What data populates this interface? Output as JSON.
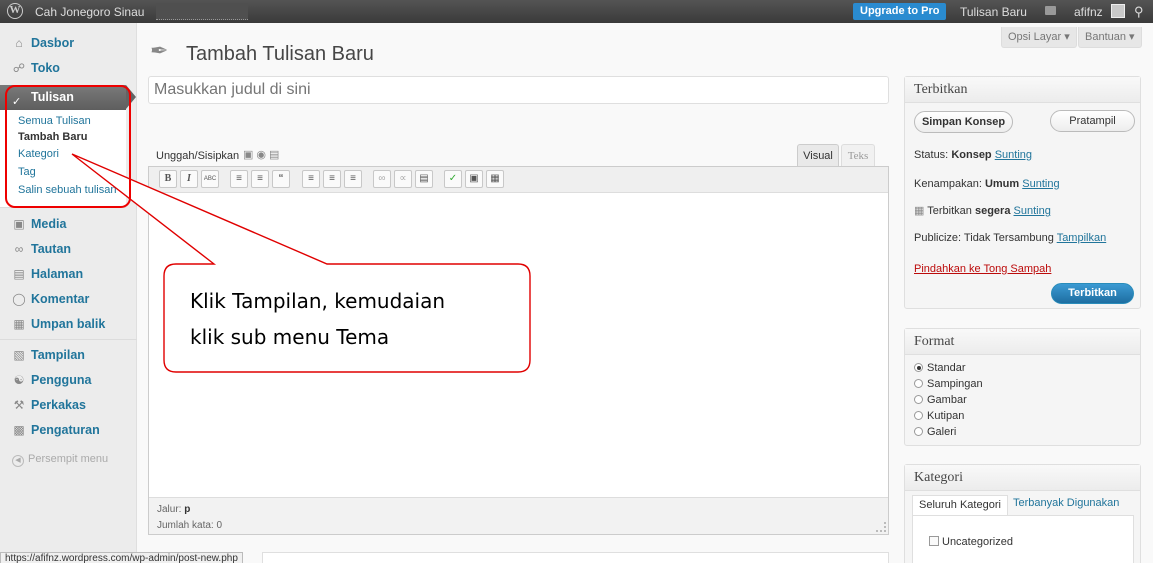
{
  "adminbar": {
    "site_name": "Cah Jonegoro Sinau",
    "upgrade": "Upgrade to Pro",
    "new_post": "Tulisan Baru",
    "user": "afifnz"
  },
  "menu": {
    "dasbor": "Dasbor",
    "toko": "Toko",
    "tulisan": "Tulisan",
    "sub": [
      "Semua Tulisan",
      "Tambah Baru",
      "Kategori",
      "Tag",
      "Salin sebuah tulisan"
    ],
    "media": "Media",
    "tautan": "Tautan",
    "halaman": "Halaman",
    "komentar": "Komentar",
    "umpan": "Umpan balik",
    "tampilan": "Tampilan",
    "pengguna": "Pengguna",
    "perkakas": "Perkakas",
    "pengaturan": "Pengaturan",
    "persempit": "Persempit menu"
  },
  "header": {
    "title": "Tambah Tulisan Baru",
    "screen_options": "Opsi Layar",
    "help": "Bantuan"
  },
  "editor": {
    "title_placeholder": "Masukkan judul di sini",
    "upload": "Unggah/Sisipkan",
    "tab_visual": "Visual",
    "tab_text": "Teks",
    "path_label": "Jalur:",
    "path_value": "p",
    "word_count": "Jumlah kata: 0"
  },
  "publish": {
    "title": "Terbitkan",
    "save_draft": "Simpan Konsep",
    "preview": "Pratampil",
    "status_label": "Status:",
    "status_value": "Konsep",
    "visibility_label": "Kenampakan:",
    "visibility_value": "Umum",
    "schedule_label": "Terbitkan",
    "schedule_value": "segera",
    "edit": "Sunting",
    "publicize": "Publicize: Tidak Tersambung",
    "show": "Tampilkan",
    "trash": "Pindahkan ke Tong Sampah",
    "publish_btn": "Terbitkan"
  },
  "format": {
    "title": "Format",
    "options": [
      "Standar",
      "Sampingan",
      "Gambar",
      "Kutipan",
      "Galeri"
    ]
  },
  "category": {
    "title": "Kategori",
    "tab_all": "Seluruh Kategori",
    "tab_popular": "Terbanyak Digunakan",
    "item": "Uncategorized"
  },
  "status_url": "https://afifnz.wordpress.com/wp-admin/post-new.php",
  "annotation": {
    "line1": "Klik Tampilan, kemudaian",
    "line2": "klik sub menu Tema"
  },
  "colors": {
    "link": "#21759b",
    "callout": "#e00000",
    "primary": "#2a8bd0"
  }
}
